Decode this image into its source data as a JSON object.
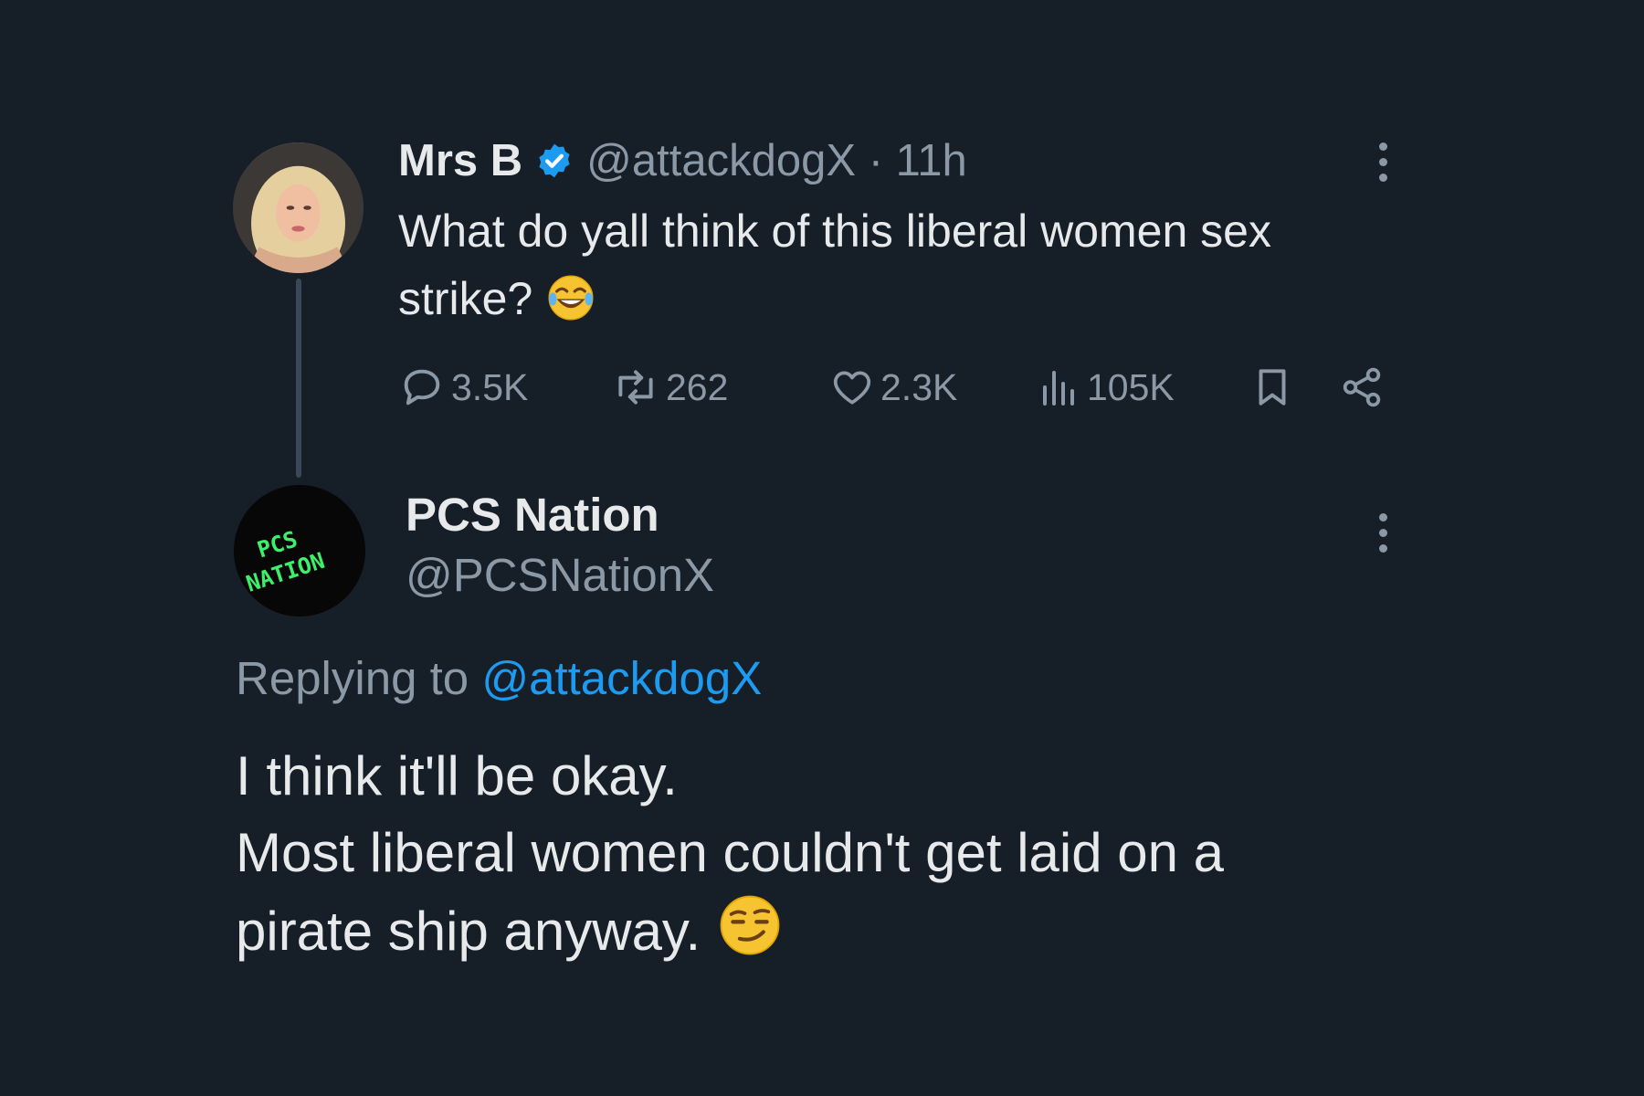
{
  "parent_tweet": {
    "display_name": "Mrs B",
    "handle": "@attackdogX",
    "separator": "·",
    "time": "11h",
    "text": "What do yall think of this liberal women sex strike?",
    "text_line1": "What do yall think of this liberal women sex",
    "text_line2": "strike?",
    "emoji": "😂",
    "stats": {
      "replies": "3.5K",
      "reposts": "262",
      "likes": "2.3K",
      "views": "105K"
    },
    "icons": [
      "verified-badge-icon",
      "reply-icon",
      "repost-icon",
      "like-icon",
      "views-icon",
      "bookmark-icon",
      "share-icon",
      "more-icon"
    ]
  },
  "reply_tweet": {
    "display_name": "PCS Nation",
    "handle": "@PCSNationX",
    "avatar_text": "PCS NATION",
    "replying_prefix": "Replying to ",
    "replying_mention": "@attackdogX",
    "line1": "I think it'll be okay.",
    "line2": "Most liberal women couldn't get laid on a",
    "line3": "pirate ship anyway.",
    "emoji": "😏"
  },
  "colors": {
    "background": "#161e28",
    "primary_text": "#e7e9ea",
    "secondary_text": "#8b98a5",
    "accent": "#1d9bf0",
    "avatar_text_green": "#3cf06a"
  }
}
